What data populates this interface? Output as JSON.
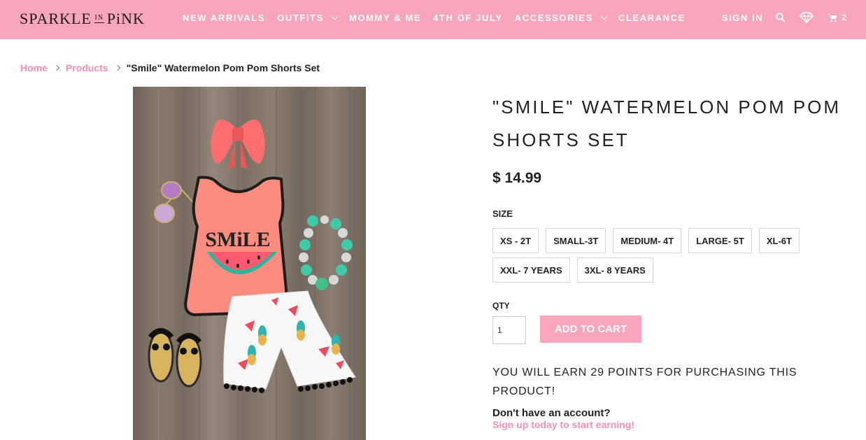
{
  "header": {
    "logo": {
      "word1": "SPARKLE",
      "word2": "IN",
      "word3": "PiNK"
    },
    "nav": [
      {
        "label": "NEW ARRIVALS",
        "has_dropdown": false
      },
      {
        "label": "OUTFITS",
        "has_dropdown": true
      },
      {
        "label": "MOMMY & ME",
        "has_dropdown": false
      },
      {
        "label": "4TH OF JULY",
        "has_dropdown": false
      },
      {
        "label": "ACCESSORIES",
        "has_dropdown": true
      },
      {
        "label": "CLEARANCE",
        "has_dropdown": false
      }
    ],
    "sign_in": "SIGN IN",
    "icons": [
      "search-icon",
      "diamond-icon",
      "cart-icon"
    ],
    "cart_count": "2"
  },
  "breadcrumb": {
    "home": "Home",
    "products": "Products",
    "current": "\"Smile\" Watermelon Pom Pom Shorts Set"
  },
  "product": {
    "title": "\"Smile\" Watermelon Pom Pom Shorts Set",
    "price": "$ 14.99",
    "size_label": "SIZE",
    "sizes": [
      "XS - 2T",
      "SMALL-3T",
      "MEDIUM- 4T",
      "LARGE- 5T",
      "XL-6T",
      "XXL- 7 YEARS",
      "3XL- 8 YEARS"
    ],
    "qty_label": "QTY",
    "qty_value": "1",
    "add_to_cart": "ADD TO CART",
    "points_text": "YOU WILL EARN 29 POINTS FOR PURCHASING THIS PRODUCT!",
    "no_account": "Don't have an account?",
    "signup": "Sign up today to start earning!",
    "image_text": "SMiLE"
  },
  "colors": {
    "brand_pink": "#f9a5bb",
    "link_pink": "#f48fb1",
    "text": "#222222"
  }
}
